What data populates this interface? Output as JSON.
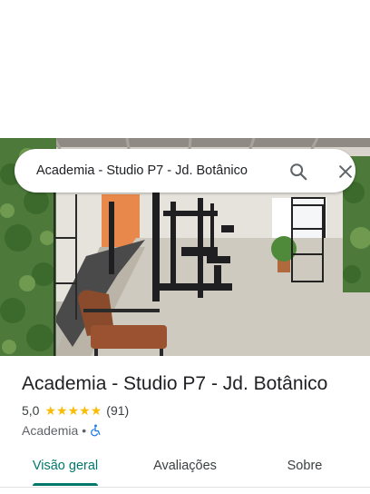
{
  "search": {
    "query": "Academia - Studio P7 - Jd. Botânico",
    "search_icon": "search-icon",
    "close_icon": "close-icon"
  },
  "place": {
    "name": "Academia - Studio P7 - Jd. Botânico",
    "rating": "5,0",
    "rating_value": 5.0,
    "stars": 5,
    "reviews_count": "(91)",
    "category": "Academia",
    "separator": "•",
    "accessibility_icon": "wheelchair-icon"
  },
  "tabs": [
    {
      "label": "Visão geral",
      "active": true
    },
    {
      "label": "Avaliações",
      "active": false
    },
    {
      "label": "Sobre",
      "active": false
    }
  ],
  "colors": {
    "accent": "#00796b",
    "star": "#fbbc04",
    "accessibility": "#1a73e8"
  }
}
